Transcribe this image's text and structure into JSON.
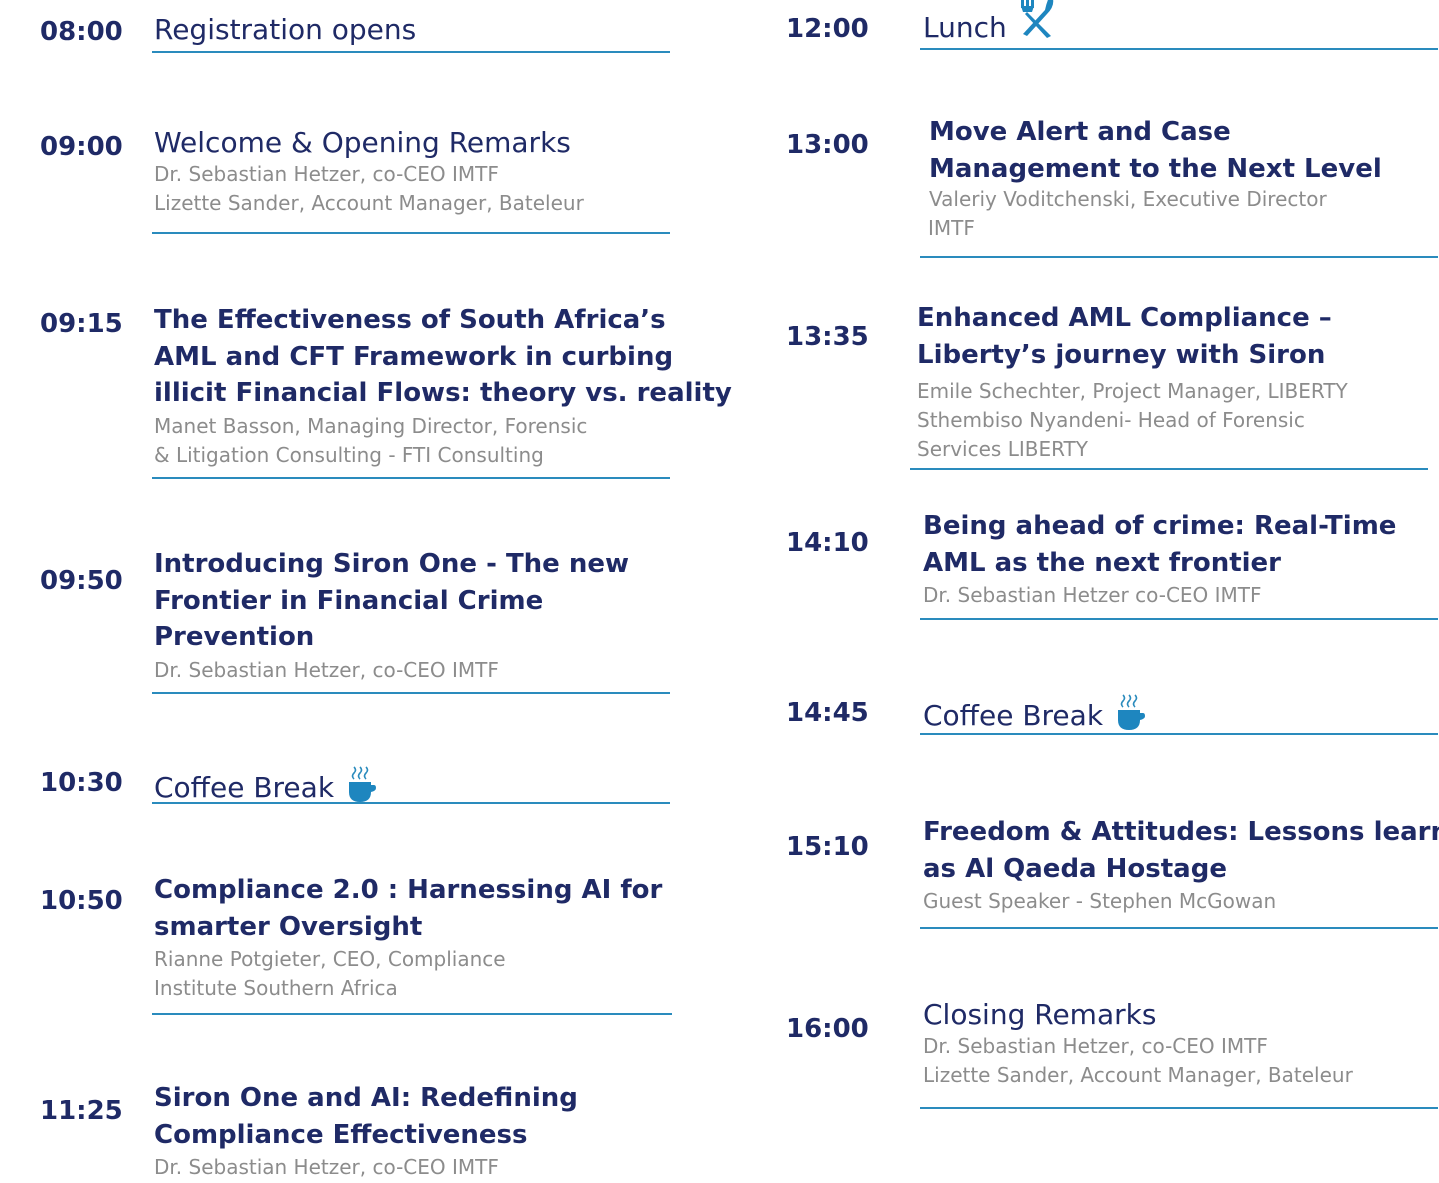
{
  "icons": {
    "coffee": "coffee-cup-icon",
    "lunch": "fork-knife-icon"
  },
  "colors": {
    "navy": "#1f2a66",
    "accent": "#2a8bbd",
    "muted": "#8c8c8c"
  },
  "left": [
    {
      "time": "08:00",
      "title": "Registration opens"
    },
    {
      "time": "09:00",
      "title": "Welcome & Opening Remarks",
      "speakers": [
        "Dr. Sebastian Hetzer, co-CEO IMTF",
        "Lizette Sander, Account Manager, Bateleur"
      ]
    },
    {
      "time": "09:15",
      "title": [
        "The Effectiveness of South Africa’s",
        "AML and CFT Framework in curbing",
        "illicit Financial Flows: theory vs. reality"
      ],
      "speakers": [
        "Manet Basson, Managing Director, Forensic",
        "& Litigation Consulting -  FTI Consulting"
      ]
    },
    {
      "time": "09:50",
      "title": [
        "Introducing Siron One -  The new",
        "Frontier in Financial Crime",
        "Prevention"
      ],
      "speakers": [
        "Dr. Sebastian Hetzer, co-CEO IMTF"
      ]
    },
    {
      "time": "10:30",
      "title": "Coffee Break"
    },
    {
      "time": "10:50",
      "title": [
        "Compliance 2.0 : Harnessing AI for",
        "smarter Oversight"
      ],
      "speakers": [
        "Rianne Potgieter, CEO, Compliance",
        "Institute Southern Africa"
      ]
    },
    {
      "time": "11:25",
      "title": [
        "Siron One and AI: Redefining",
        "Compliance Effectiveness"
      ],
      "speakers": [
        "Dr. Sebastian Hetzer, co-CEO IMTF"
      ]
    }
  ],
  "right": [
    {
      "time": "12:00",
      "title": "Lunch"
    },
    {
      "time": "13:00",
      "title": [
        "Move Alert and Case",
        "Management to the Next Level"
      ],
      "speakers": [
        "Valeriy Voditchenski,  Executive Director",
        "IMTF"
      ]
    },
    {
      "time": "13:35",
      "title": [
        "Enhanced AML Compliance –",
        "Liberty’s journey with Siron"
      ],
      "speakers": [
        "Emile Schechter, Project Manager, LIBERTY",
        "Sthembiso Nyandeni- Head of Forensic",
        "Services LIBERTY"
      ]
    },
    {
      "time": "14:10",
      "title": [
        "Being ahead of crime: Real-Time",
        "AML as the next frontier"
      ],
      "speakers": [
        "Dr. Sebastian Hetzer co-CEO IMTF"
      ]
    },
    {
      "time": "14:45",
      "title": "Coffee Break"
    },
    {
      "time": "15:10",
      "title": [
        "Freedom & Attitudes: Lessons learnt",
        "as Al Qaeda Hostage"
      ],
      "speakers": [
        "Guest Speaker -  Stephen McGowan"
      ]
    },
    {
      "time": "16:00",
      "title": "Closing Remarks",
      "speakers": [
        "Dr. Sebastian Hetzer, co-CEO IMTF",
        "Lizette Sander, Account Manager, Bateleur"
      ]
    }
  ]
}
